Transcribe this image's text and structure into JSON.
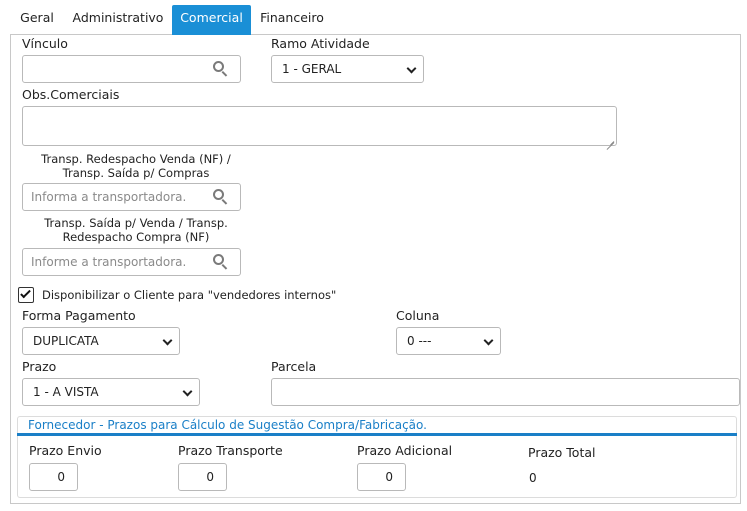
{
  "tabs": [
    {
      "label": "Geral"
    },
    {
      "label": "Administrativo"
    },
    {
      "label": "Comercial"
    },
    {
      "label": "Financeiro"
    }
  ],
  "active_tab": "Comercial",
  "form": {
    "vinculo_label": "Vínculo",
    "ramo_label": "Ramo Atividade",
    "ramo_value": "1 - GERAL",
    "obs_label": "Obs.Comerciais",
    "transp1_label_line1": "Transp. Redespacho Venda (NF) /",
    "transp1_label_line2": "Transp. Saída p/ Compras",
    "transp1_placeholder": "Informa a transportadora.",
    "transp2_label_line1": "Transp. Saída p/ Venda / Transp.",
    "transp2_label_line2": "Redespacho Compra (NF)",
    "transp2_placeholder": "Informe a transportadora.",
    "checkbox_label": "Disponibilizar o Cliente para \"vendedores internos\"",
    "checkbox_checked": true,
    "forma_label": "Forma Pagamento",
    "forma_value": "DUPLICATA",
    "coluna_label": "Coluna",
    "coluna_value": "0 ---",
    "prazo_label": "Prazo",
    "prazo_value": "1 - A VISTA",
    "parcela_label": "Parcela"
  },
  "fornecedor": {
    "legend": "Fornecedor - Prazos para Cálculo de Sugestão Compra/Fabricação.",
    "prazo_envio_label": "Prazo Envio",
    "prazo_envio_value": "0",
    "prazo_transporte_label": "Prazo Transporte",
    "prazo_transporte_value": "0",
    "prazo_adicional_label": "Prazo Adicional",
    "prazo_adicional_value": "0",
    "prazo_total_label": "Prazo Total",
    "prazo_total_value": "0"
  },
  "colors": {
    "accent": "#1a8fd6",
    "legend": "#1a7fc7"
  }
}
